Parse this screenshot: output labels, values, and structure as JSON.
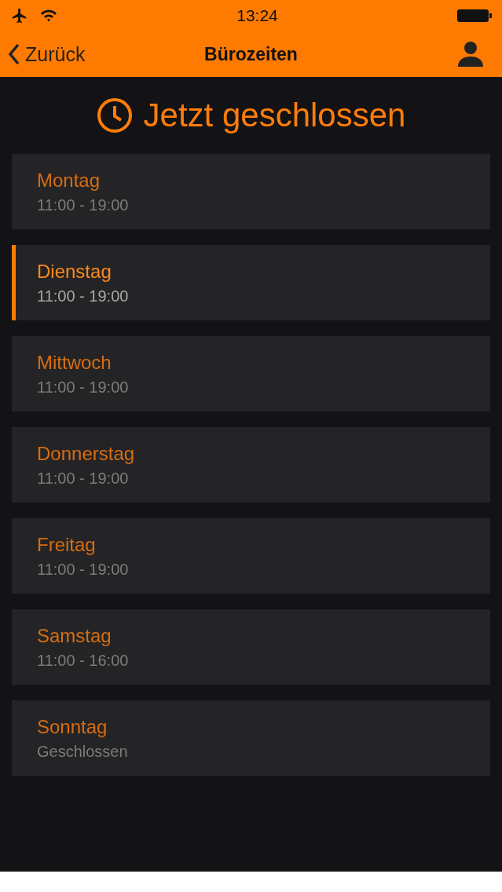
{
  "status_bar": {
    "time": "13:24"
  },
  "nav": {
    "back": "Zurück",
    "title": "Bürozeiten"
  },
  "status": {
    "text": "Jetzt geschlossen"
  },
  "days": [
    {
      "name": "Montag",
      "hours": "11:00 - 19:00",
      "selected": false
    },
    {
      "name": "Dienstag",
      "hours": "11:00 - 19:00",
      "selected": true
    },
    {
      "name": "Mittwoch",
      "hours": "11:00 - 19:00",
      "selected": false
    },
    {
      "name": "Donnerstag",
      "hours": "11:00 - 19:00",
      "selected": false
    },
    {
      "name": "Freitag",
      "hours": "11:00 - 19:00",
      "selected": false
    },
    {
      "name": "Samstag",
      "hours": "11:00 - 16:00",
      "selected": false
    },
    {
      "name": "Sonntag",
      "hours": "Geschlossen",
      "selected": false
    }
  ]
}
